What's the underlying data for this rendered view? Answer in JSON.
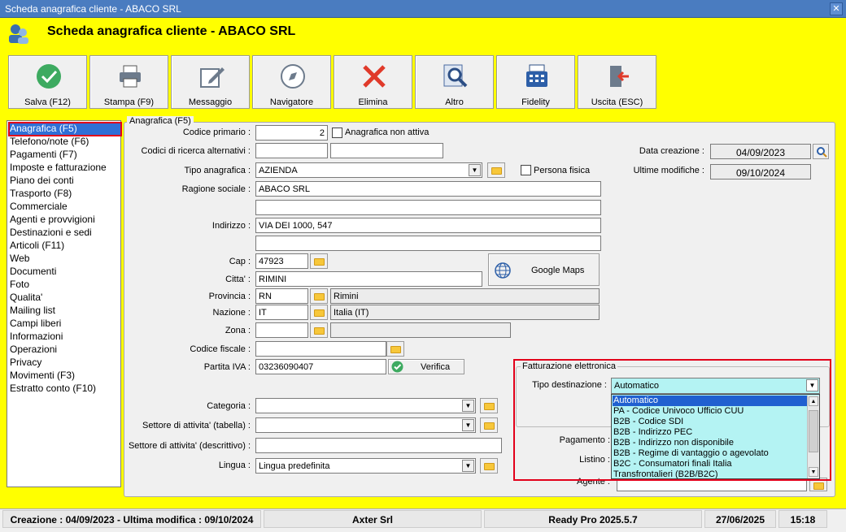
{
  "window": {
    "title": "Scheda anagrafica cliente - ABACO SRL",
    "close_icon": "close-icon"
  },
  "header": {
    "title": "Scheda anagrafica cliente - ABACO SRL"
  },
  "toolbar": [
    {
      "label": "Salva (F12)",
      "icon": "check-circle-icon",
      "color": "#3daa60"
    },
    {
      "label": "Stampa (F9)",
      "icon": "printer-icon"
    },
    {
      "label": "Messaggio",
      "icon": "compose-icon"
    },
    {
      "label": "Navigatore",
      "icon": "compass-icon"
    },
    {
      "label": "Elimina",
      "icon": "x-icon",
      "color": "#e03a2a"
    },
    {
      "label": "Altro",
      "icon": "magnifier-icon"
    },
    {
      "label": "Fidelity",
      "icon": "cash-register-icon"
    },
    {
      "label": "Uscita (ESC)",
      "icon": "exit-door-icon"
    }
  ],
  "nav": [
    "Anagrafica (F5)",
    "Telefono/note (F6)",
    "Pagamenti (F7)",
    "Imposte e fatturazione",
    "Piano dei conti",
    "Trasporto (F8)",
    "Commerciale",
    "Agenti e provvigioni",
    "Destinazioni e sedi",
    "Articoli (F11)",
    "Web",
    "Documenti",
    "Foto",
    "Qualita'",
    "Mailing list",
    "Campi liberi",
    "Informazioni",
    "Operazioni",
    "Privacy",
    "Movimenti (F3)",
    "Estratto conto (F10)"
  ],
  "form": {
    "group_title": "Anagrafica (F5)",
    "codice_primario_label": "Codice primario :",
    "codice_primario": "2",
    "non_attiva_label": "Anagrafica non attiva",
    "codici_alt_label": "Codici di ricerca alternativi :",
    "tipo_anagrafica_label": "Tipo anagrafica :",
    "tipo_anagrafica": "AZIENDA",
    "persona_fisica_label": "Persona fisica",
    "ragione_sociale_label": "Ragione sociale :",
    "ragione_sociale": "ABACO SRL",
    "indirizzo_label": "Indirizzo :",
    "indirizzo": "VIA DEI 1000, 547",
    "cap_label": "Cap :",
    "cap": "47923",
    "citta_label": "Citta' :",
    "citta": "RIMINI",
    "google_maps_label": "Google Maps",
    "provincia_label": "Provincia :",
    "provincia": "RN",
    "provincia_desc": "Rimini",
    "nazione_label": "Nazione :",
    "nazione": "IT",
    "nazione_desc": "Italia (IT)",
    "zona_label": "Zona :",
    "codice_fiscale_label": "Codice fiscale :",
    "partita_iva_label": "Partita IVA :",
    "partita_iva": "03236090407",
    "verifica_label": "Verifica",
    "categoria_label": "Categoria :",
    "settore_tab_label": "Settore di attivita' (tabella) :",
    "settore_desc_label": "Settore di attivita' (descrittivo) :",
    "lingua_label": "Lingua :",
    "lingua": "Lingua predefinita",
    "data_creazione_label": "Data creazione :",
    "data_creazione": "04/09/2023",
    "ultime_modifiche_label": "Ultime modifiche :",
    "ultime_modifiche": "09/10/2024",
    "pagamento_label": "Pagamento :",
    "listino_label": "Listino :",
    "agente_label": "Agente :"
  },
  "fe": {
    "title": "Fatturazione elettronica",
    "tipo_label": "Tipo destinazione :",
    "tipo_value": "Automatico",
    "options": [
      "Automatico",
      "PA - Codice Univoco Ufficio CUU",
      "B2B - Codice SDI",
      "B2B - Indirizzo PEC",
      "B2B - Indirizzo non disponibile",
      "B2B - Regime di vantaggio o agevolato",
      "B2C - Consumatori finali Italia",
      "Transfrontalieri (B2B/B2C)"
    ]
  },
  "status": {
    "dates": "Creazione : 04/09/2023 - Ultima modifica : 09/10/2024",
    "company": "Axter Srl",
    "product": "Ready Pro 2025.5.7",
    "date": "27/06/2025",
    "time": "15:18"
  }
}
